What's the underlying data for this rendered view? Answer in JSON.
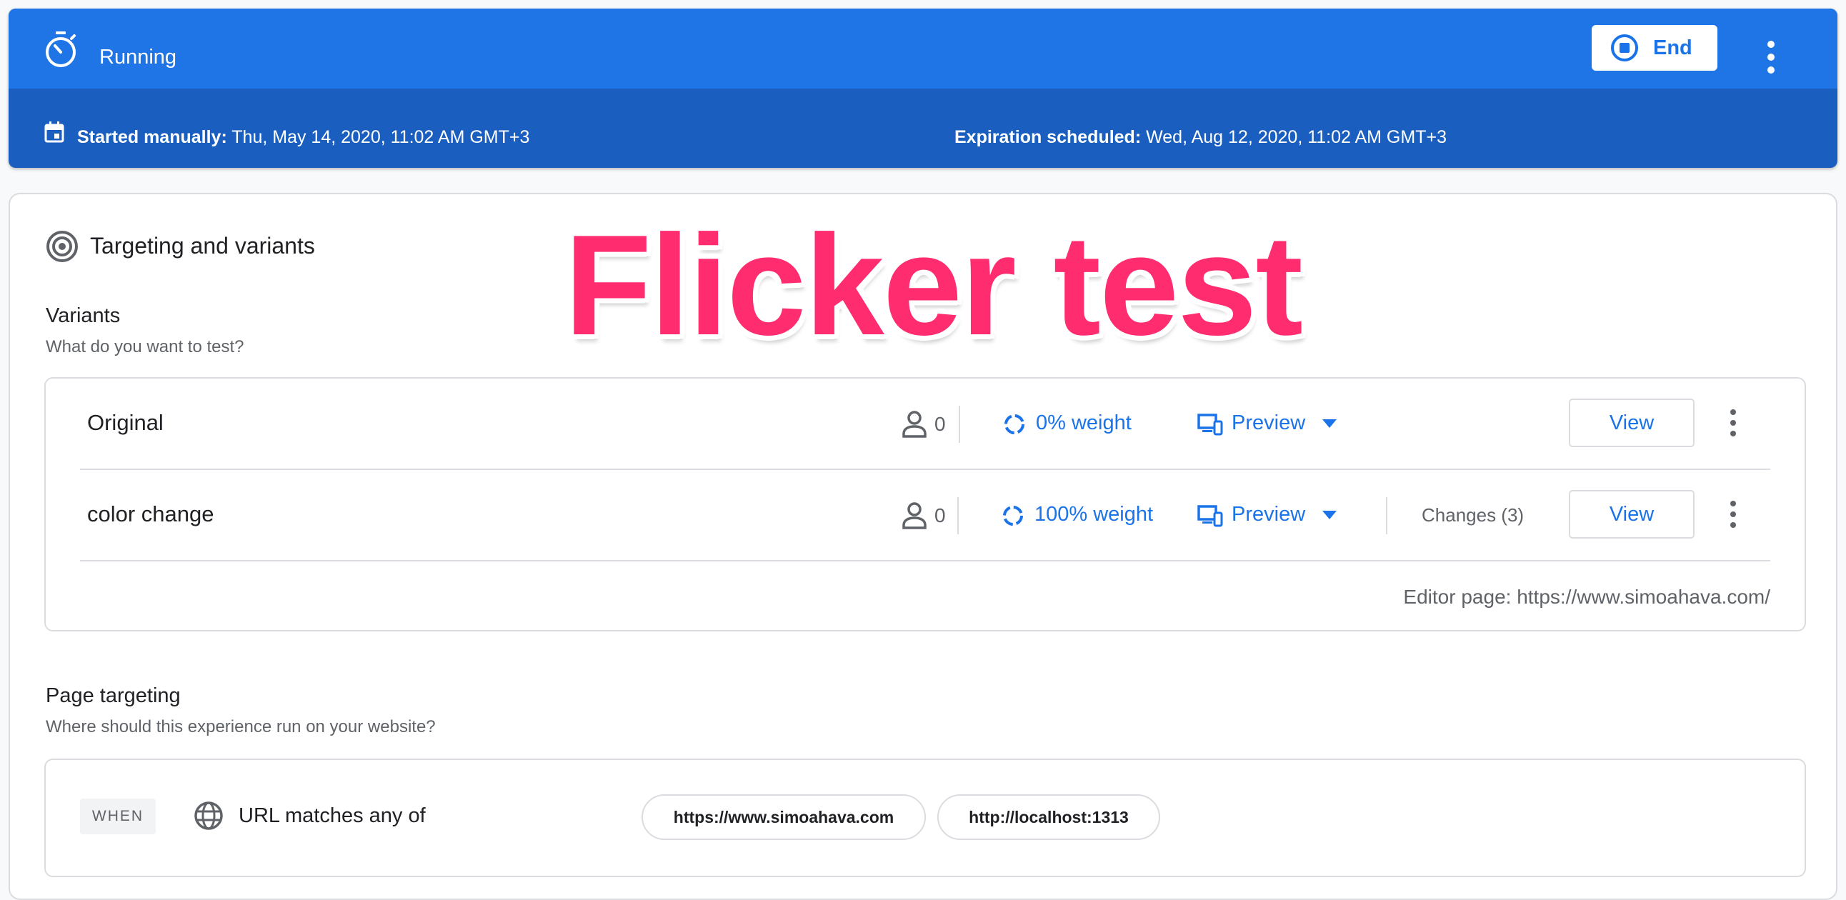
{
  "header": {
    "status": "Running",
    "end_button": "End",
    "started_label": "Started manually:",
    "started_value": " Thu, May 14, 2020, 11:02 AM GMT+3",
    "expiration_label": "Expiration scheduled:",
    "expiration_value": " Wed, Aug 12, 2020, 11:02 AM GMT+3",
    "icons": [
      "timer-icon",
      "stop-icon",
      "more-vert-icon",
      "calendar-icon"
    ]
  },
  "section": {
    "title": "Targeting and variants"
  },
  "variants": {
    "heading": "Variants",
    "description": "What do you want to test?",
    "rows": [
      {
        "name": "Original",
        "users": "0",
        "weight": "0% weight",
        "preview": "Preview",
        "changes": "",
        "view": "View"
      },
      {
        "name": "color change",
        "users": "0",
        "weight": "100% weight",
        "preview": "Preview",
        "changes": "Changes (3)",
        "view": "View"
      }
    ],
    "editor_page": "Editor page: https://www.simoahava.com/"
  },
  "page_targeting": {
    "heading": "Page targeting",
    "description": "Where should this experience run on your website?",
    "when": "WHEN",
    "rule": "URL matches any of",
    "urls": [
      "https://www.simoahava.com",
      "http://localhost:1313"
    ]
  },
  "overlay": {
    "title": "Flicker test"
  },
  "colors": {
    "header_top": "#1f74e6",
    "header_bottom": "#1a5fc0",
    "accent": "#1a73e8",
    "overlay": "#ff2d6f"
  }
}
